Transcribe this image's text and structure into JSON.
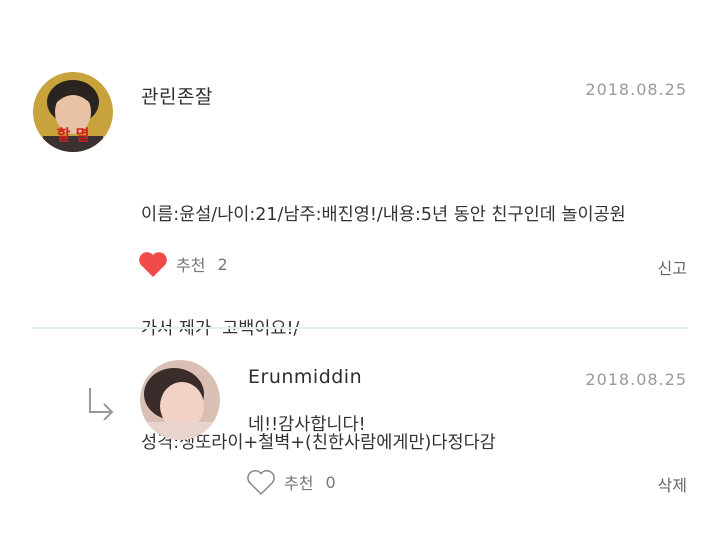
{
  "comment": {
    "author": "관린존잘",
    "date": "2018.08.25",
    "text_lines": [
      "이름:윤설/나이:21/남주:배진영!/내용:5년 동안 친구인데 놀이공원",
      "가서 제가  고백이요!/",
      "성격:생또라이+철벽+(친한사람에게만)다정다감"
    ],
    "avatar_overlay": "할 멸",
    "like_label": "추천",
    "like_count": "2",
    "liked": true,
    "report_label": "신고"
  },
  "reply": {
    "author": "Erunmiddin",
    "date": "2018.08.25",
    "text": "네!!감사합니다!",
    "like_label": "추천",
    "like_count": "0",
    "liked": false,
    "delete_label": "삭제"
  },
  "colors": {
    "heart_filled": "#f04a4a",
    "divider": "#e3eef0",
    "date": "#9a9a9a"
  }
}
